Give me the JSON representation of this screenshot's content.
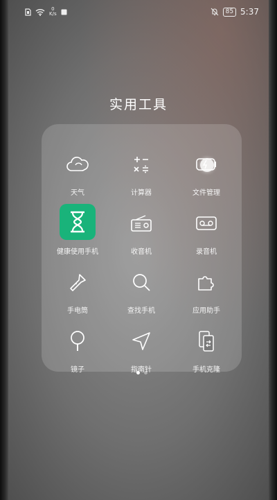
{
  "status_bar": {
    "network_speed_value": "0",
    "network_speed_unit": "K/s",
    "battery": "85",
    "time": "5:37"
  },
  "folder": {
    "title": "实用工具",
    "apps": [
      {
        "label": "天气",
        "icon": "cloud-icon"
      },
      {
        "label": "计算器",
        "icon": "calculator-icon"
      },
      {
        "label": "文件管理",
        "icon": "file-manager-icon"
      },
      {
        "label": "健康使用手机",
        "icon": "hourglass-icon",
        "highlight_color": "#19B37A"
      },
      {
        "label": "收音机",
        "icon": "radio-icon"
      },
      {
        "label": "录音机",
        "icon": "tape-recorder-icon"
      },
      {
        "label": "手电筒",
        "icon": "flashlight-icon"
      },
      {
        "label": "查找手机",
        "icon": "search-icon"
      },
      {
        "label": "应用助手",
        "icon": "puzzle-icon"
      },
      {
        "label": "镜子",
        "icon": "mirror-icon"
      },
      {
        "label": "指南针",
        "icon": "compass-arrow-icon"
      },
      {
        "label": "手机克隆",
        "icon": "phone-clone-icon"
      }
    ],
    "page_count": 2,
    "current_page": 1
  }
}
